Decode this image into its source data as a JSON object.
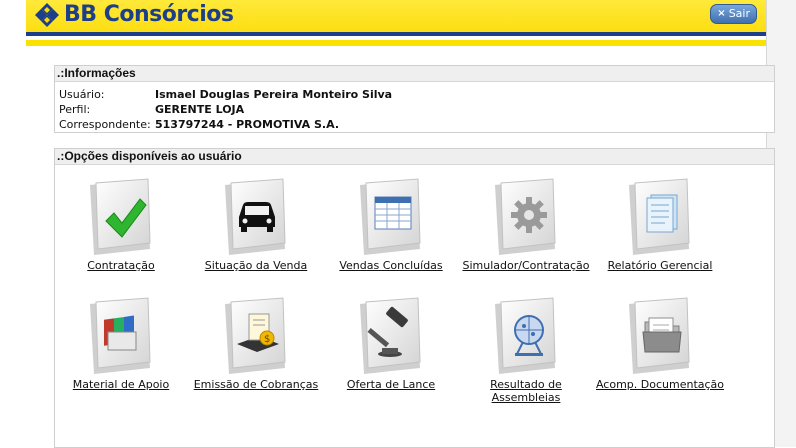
{
  "header": {
    "logo_text": "BB Consórcios",
    "logout_label": "Sair",
    "brand_blue": "#1d3f8a",
    "brand_yellow": "#fbd900"
  },
  "info": {
    "title": ".:Informações",
    "rows": [
      {
        "label": "Usuário:",
        "value": "Ismael Douglas Pereira Monteiro Silva"
      },
      {
        "label": "Perfil:",
        "value": "GERENTE LOJA"
      },
      {
        "label": "Correspondente:",
        "value": "513797244 - PROMOTIVA S.A."
      }
    ]
  },
  "options": {
    "title": ".:Opções disponíveis ao usuário",
    "tiles": [
      {
        "label": "Contratação",
        "icon": "checkmark-icon"
      },
      {
        "label": "Situação da Venda",
        "icon": "car-icon"
      },
      {
        "label": "Vendas Concluídas",
        "icon": "spreadsheet-icon"
      },
      {
        "label": "Simulador/Contratação",
        "icon": "gear-icon"
      },
      {
        "label": "Relatório Gerencial",
        "icon": "report-icon"
      },
      {
        "label": "Material de Apoio",
        "icon": "books-icon"
      },
      {
        "label": "Emissão de Cobranças",
        "icon": "invoice-icon"
      },
      {
        "label": "Oferta de Lance",
        "icon": "gavel-icon"
      },
      {
        "label": "Resultado de Assembleias",
        "icon": "lottery-cage-icon"
      },
      {
        "label": "Acomp. Documentação",
        "icon": "folder-icon"
      }
    ]
  }
}
